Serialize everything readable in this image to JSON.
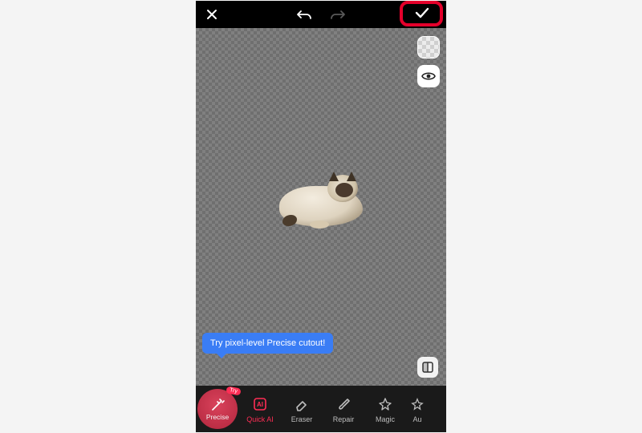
{
  "topbar": {
    "close": "✕",
    "undo": "undo",
    "redo": "redo",
    "confirm": "✓"
  },
  "side": {
    "background_toggle": "transparent-bg",
    "visibility_toggle": "preview"
  },
  "tooltip": {
    "text": "Try pixel-level Precise cutout!"
  },
  "subject": {
    "name": "cat-cutout"
  },
  "tools": {
    "precise": {
      "label": "Precise",
      "badge": "Try"
    },
    "quick_ai": {
      "label": "Quick AI"
    },
    "eraser": {
      "label": "Eraser"
    },
    "repair": {
      "label": "Repair"
    },
    "magic": {
      "label": "Magic"
    },
    "auto": {
      "label": "Au"
    }
  },
  "colors": {
    "accent": "#ff2d55",
    "tooltip": "#3a7df5",
    "highlight": "#e4002b"
  }
}
